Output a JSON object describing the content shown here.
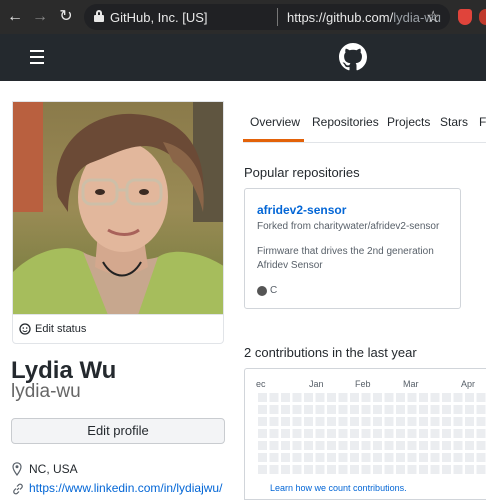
{
  "browser": {
    "org": "GitHub, Inc. [US]",
    "url_scheme": "https://github.com/",
    "url_path": "lydia-wu"
  },
  "profile": {
    "edit_status": "Edit status",
    "full_name": "Lydia Wu",
    "username": "lydia-wu",
    "edit_profile": "Edit profile",
    "location": "NC, USA",
    "website": "https://www.linkedin.com/in/lydiajwu/"
  },
  "tabs": [
    "Overview",
    "Repositories",
    "Projects",
    "Stars",
    "F"
  ],
  "popular": {
    "title": "Popular repositories",
    "repos": [
      {
        "name": "afridev2-sensor",
        "fork": "Forked from charitywater/afridev2-sensor",
        "desc": "Firmware that drives the 2nd generation Afridev Sensor",
        "language": "C",
        "language_color": "#555555"
      }
    ]
  },
  "contributions": {
    "title": "2 contributions in the last year",
    "months": [
      "ec",
      "Jan",
      "Feb",
      "Mar",
      "Apr"
    ],
    "learn": "Learn how we count contributions.",
    "empty_color": "#ebedf0"
  },
  "colors": {
    "header_bg": "#24292e",
    "link": "#0366d6",
    "tab_accent": "#e36209"
  }
}
